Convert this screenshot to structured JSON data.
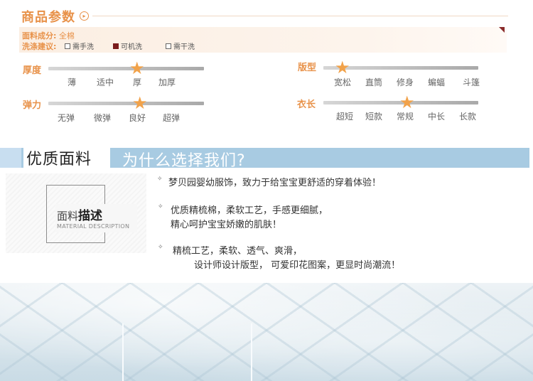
{
  "header": {
    "title": "商品参数",
    "arrow": "▸"
  },
  "info": {
    "fabric_label": "面料成分:",
    "fabric_value": "全棉",
    "wash_label": "洗涤建议:",
    "wash_options": [
      {
        "label": "需手洗",
        "checked": false
      },
      {
        "label": "可机洗",
        "checked": true
      },
      {
        "label": "需干洗",
        "checked": false
      }
    ]
  },
  "attributes": {
    "thickness": {
      "label": "厚度",
      "options": [
        "薄",
        "适中",
        "厚",
        "加厚"
      ],
      "selected": "厚"
    },
    "elasticity": {
      "label": "弹力",
      "options": [
        "无弹",
        "微弹",
        "良好",
        "超弹"
      ],
      "selected": "良好"
    },
    "fit": {
      "label": "版型",
      "options": [
        "宽松",
        "直筒",
        "修身",
        "蝙蝠",
        "斗篷"
      ],
      "selected": "宽松"
    },
    "length": {
      "label": "衣长",
      "options": [
        "超短",
        "短款",
        "常规",
        "中长",
        "长款"
      ],
      "selected": "常规"
    }
  },
  "banner": {
    "left_title": "优质面料",
    "right_title": "为什么选择我们?"
  },
  "description": {
    "title_prefix": "面料",
    "title_bold": "描述",
    "subtitle": "MATERIAL DESCRIPTION",
    "bullet_glyph": "✧",
    "points": [
      [
        "梦贝园婴幼服饰，致力于给宝宝更舒适的穿着体验！"
      ],
      [
        "优质精梳棉，柔软工艺，手感更细腻，",
        "精心呵护宝宝娇嫩的肌肤！"
      ],
      [
        "精梳工艺，柔软、透气、爽滑，",
        "设计师设计版型， 可爱印花图案，更显时尚潮流！"
      ]
    ]
  },
  "colors": {
    "accent": "#e8924a",
    "banner": "#a8cbe2",
    "star": "#f1a24a",
    "wash_checked": "#7a1b1b"
  },
  "icons": {
    "star": "★"
  }
}
